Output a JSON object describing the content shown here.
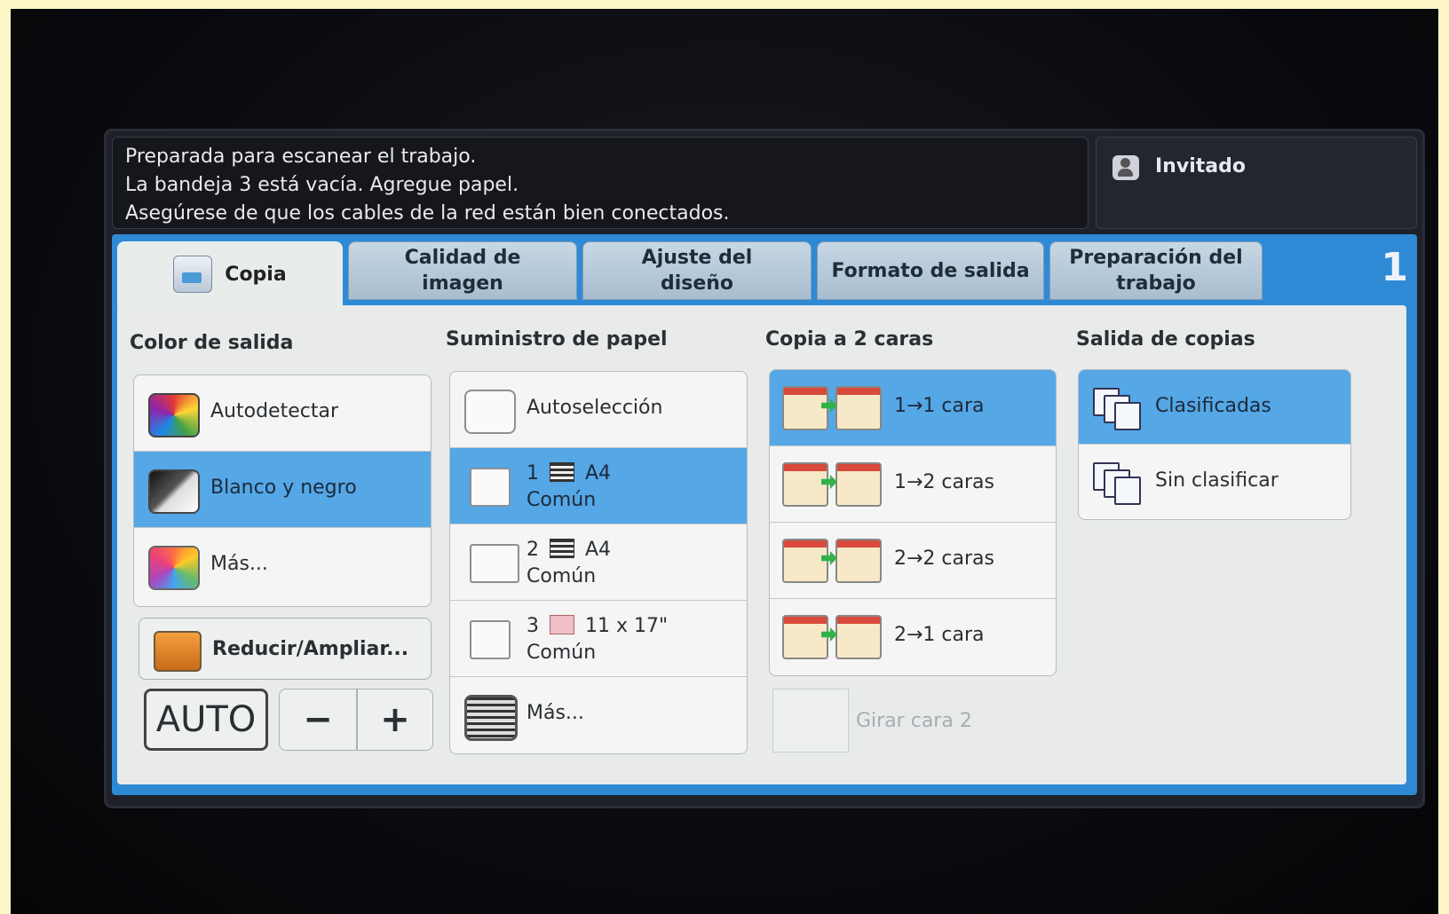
{
  "status": {
    "line1": "Preparada para escanear el trabajo.",
    "line2": "La bandeja 3 está vacía. Agregue papel.",
    "line3": "Asegúrese de que los cables de la red están bien conectados."
  },
  "user": {
    "label": "Invitado",
    "icon": "user-icon"
  },
  "tabs": [
    {
      "label": "Copia",
      "icon": "copy-icon",
      "active": true
    },
    {
      "label": "Calidad de imagen"
    },
    {
      "label": "Ajuste del diseño"
    },
    {
      "label": "Formato de salida"
    },
    {
      "label": "Preparación del trabajo"
    }
  ],
  "page_number": "1",
  "output_color": {
    "title": "Color de salida",
    "options": [
      {
        "label": "Autodetectar",
        "icon": "color-autodetect-icon",
        "selected": false
      },
      {
        "label": "Blanco y negro",
        "icon": "black-white-icon",
        "selected": true
      },
      {
        "label": "Más...",
        "icon": "more-colors-icon",
        "selected": false
      }
    ]
  },
  "reduce_enlarge": {
    "label": "Reducir/Ampliar...",
    "auto_label": "AUTO",
    "minus": "−",
    "plus": "+"
  },
  "paper_supply": {
    "title": "Suministro de papel",
    "options": [
      {
        "label": "Autoselección",
        "selected": false
      },
      {
        "tray": "1",
        "size": "A4",
        "type": "Común",
        "selected": true
      },
      {
        "tray": "2",
        "size": "A4",
        "type": "Común",
        "selected": false
      },
      {
        "tray": "3",
        "size": "11 x 17\"",
        "type": "Común",
        "selected": false
      },
      {
        "label": "Más...",
        "selected": false
      }
    ]
  },
  "two_sided": {
    "title": "Copia a 2 caras",
    "options": [
      {
        "label": "1→1 cara",
        "selected": true
      },
      {
        "label": "1→2 caras",
        "selected": false
      },
      {
        "label": "2→2 caras",
        "selected": false
      },
      {
        "label": "2→1 cara",
        "selected": false
      }
    ],
    "rotate_label": "Girar cara 2"
  },
  "copy_output": {
    "title": "Salida de copias",
    "options": [
      {
        "label": "Clasificadas",
        "selected": true
      },
      {
        "label": "Sin clasificar",
        "selected": false
      }
    ]
  },
  "colors": {
    "selected": "#55a7e6",
    "panel": "#2f8ad6"
  }
}
